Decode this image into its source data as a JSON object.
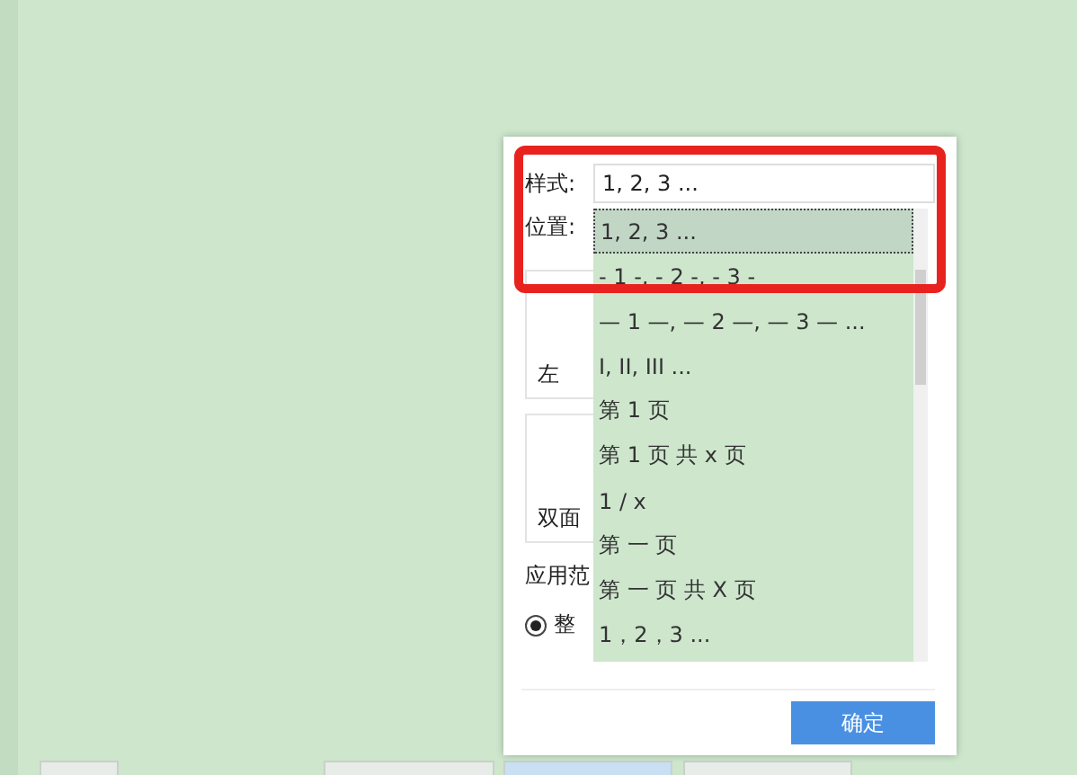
{
  "taskbar": {
    "tabs": [
      {
        "selected": false
      },
      {
        "selected": false
      },
      {
        "selected": true
      },
      {
        "selected": false
      }
    ]
  },
  "dialog": {
    "style_label": "样式:",
    "style_value": "1, 2, 3 ...",
    "position_label": "位置:",
    "preview_cards": [
      {
        "caption": "左"
      },
      {
        "caption": "双面"
      }
    ],
    "apply_label": "应用范",
    "apply_option": {
      "label": "整",
      "selected": true
    },
    "confirm_button": "确定"
  },
  "dropdown": {
    "items": [
      {
        "label": "1, 2, 3 ...",
        "selected": true
      },
      {
        "label": "- 1 -, - 2 -, - 3 -",
        "selected": false
      },
      {
        "label": "— 1 —, — 2 —, — 3 — ...",
        "selected": false
      },
      {
        "label": "I, II, III ...",
        "selected": false
      },
      {
        "label": "第 1 页",
        "selected": false
      },
      {
        "label": "第 1 页 共 x 页",
        "selected": false
      },
      {
        "label": "1 / x",
        "selected": false
      },
      {
        "label": "第 一 页",
        "selected": false
      },
      {
        "label": "第 一 页 共 X 页",
        "selected": false
      },
      {
        "label": "1，2，3 ...",
        "selected": false
      }
    ]
  }
}
